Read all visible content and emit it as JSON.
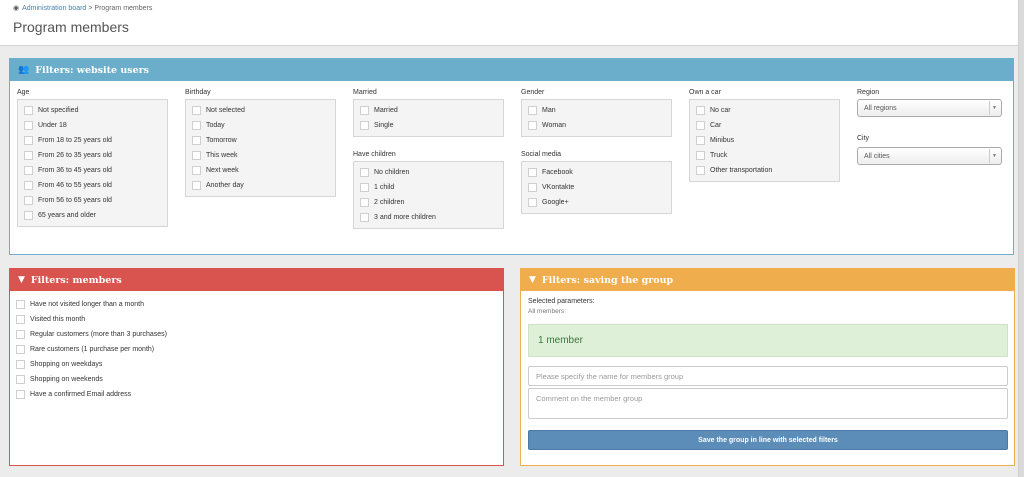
{
  "breadcrumb": {
    "home_icon": "dashboard-icon",
    "link": "Administration board",
    "separator": ">",
    "current": "Program members"
  },
  "page_title": "Program members",
  "users_panel": {
    "title": "Filters: website users",
    "icon": "users-icon",
    "accent": "#6baecb",
    "age": {
      "label": "Age",
      "options": [
        "Not specified",
        "Under 18",
        "From 18 to 25 years old",
        "From 26 to 35 years old",
        "From 36 to 45 years old",
        "From 46 to 55 years old",
        "From 56 to 65 years old",
        "65 years and older"
      ]
    },
    "birthday": {
      "label": "Birthday",
      "options": [
        "Not selected",
        "Today",
        "Tomorrow",
        "This week",
        "Next week",
        "Another day"
      ]
    },
    "married": {
      "label": "Married",
      "options": [
        "Married",
        "Single"
      ]
    },
    "children": {
      "label": "Have children",
      "options": [
        "No children",
        "1 child",
        "2 children",
        "3 and more children"
      ]
    },
    "gender": {
      "label": "Gender",
      "options": [
        "Man",
        "Woman"
      ]
    },
    "social": {
      "label": "Social media",
      "options": [
        "Facebook",
        "VKontakte",
        "Google+"
      ]
    },
    "car": {
      "label": "Own a car",
      "options": [
        "No car",
        "Car",
        "Minibus",
        "Truck",
        "Other transportation"
      ]
    },
    "region": {
      "label": "Region",
      "selected": "All regions"
    },
    "city": {
      "label": "City",
      "selected": "All cities"
    }
  },
  "members_panel": {
    "title": "Filters: members",
    "icon": "filter-icon",
    "accent": "#d9534f",
    "options": [
      "Have not visited longer than a month",
      "Visited this month",
      "Regular customers (more than 3 purchases)",
      "Rare customers (1 purchase per month)",
      "Shopping on weekdays",
      "Shopping on weekends",
      "Have a confirmed Email address"
    ]
  },
  "saving_panel": {
    "title": "Filters: saving the group",
    "icon": "filter-icon",
    "accent": "#f0ad4e",
    "selected_label": "Selected parameters:",
    "selected_value": "All members",
    "result": "1 member",
    "name_placeholder": "Please specify the name for members group",
    "comment_placeholder": "Comment on the member group",
    "save_button": "Save the group in line with selected filters"
  }
}
